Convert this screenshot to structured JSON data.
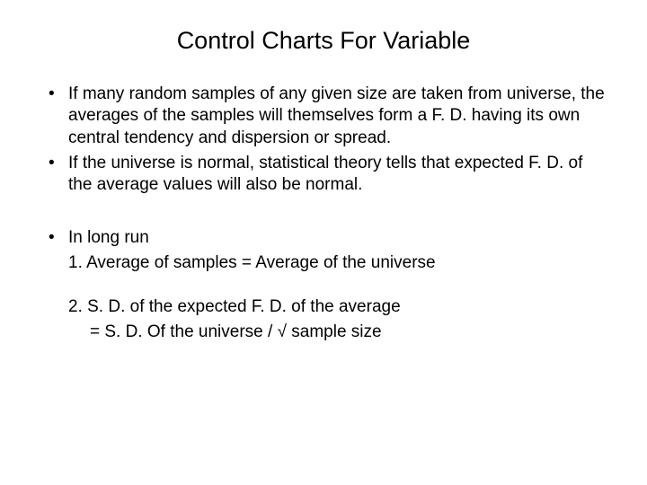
{
  "slide": {
    "title": "Control Charts For Variable",
    "bullets": [
      {
        "text": "If many random samples of any given size are taken from universe, the averages of the samples will themselves form a F. D. having its own central tendency and dispersion or spread."
      },
      {
        "text": "If the universe is normal, statistical theory tells that expected F. D. of the average values will also be normal."
      },
      {
        "text": "In long run",
        "subs": [
          "1. Average of samples = Average of the universe",
          "2. S. D. of the expected F. D. of the average",
          "    = S. D. Of the universe / √ sample size"
        ]
      }
    ]
  }
}
